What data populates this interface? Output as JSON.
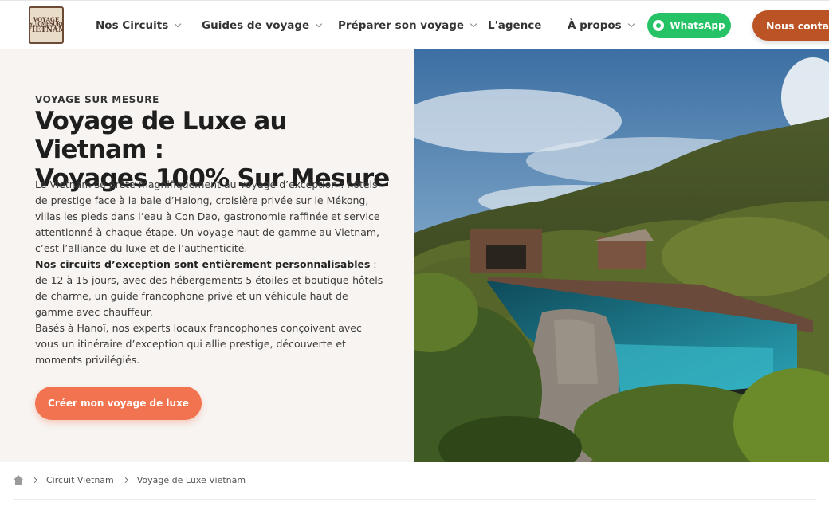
{
  "brand": {
    "logo_line1": "VOYAGE",
    "logo_line2": "SUR MESURE",
    "logo_line3": "VIETNAM"
  },
  "nav": {
    "items": [
      {
        "label": "Nos Circuits",
        "has_dropdown": true
      },
      {
        "label": "Guides de voyage",
        "has_dropdown": true
      },
      {
        "label": "Préparer son voyage",
        "has_dropdown": true
      },
      {
        "label": "L'agence",
        "has_dropdown": false
      },
      {
        "label": "À propos",
        "has_dropdown": true
      }
    ],
    "whatsapp_label": "WhatsApp",
    "contact_label": "Nous contacter"
  },
  "hero": {
    "eyebrow": "VOYAGE SUR MESURE",
    "title_line1": "Voyage de Luxe au Vietnam :",
    "title_line2": "Voyages 100% Sur Mesure",
    "paragraph1": "Le Vietnam se prête magnifiquement au voyage d’exception : hôtels de prestige face à la baie d’Halong, croisière privée sur le Mékong, villas les pieds dans l’eau à Con Dao, gastronomie raffinée et service attentionné à chaque étape. Un voyage haut de gamme au Vietnam, c’est l’alliance du luxe et de l’authenticité.",
    "paragraph2_bold": "Nos circuits d’exception sont entièrement personnalisables",
    "paragraph2_rest": " : de 12 à 15 jours, avec des hébergements 5 étoiles et boutique-hôtels de charme, un guide francophone privé et un véhicule haut de gamme avec chauffeur.",
    "paragraph3": "Basés à Hanoï, nos experts locaux francophones conçoivent avec vous un itinéraire d’exception qui allie prestige, découverte et moments privilégiés.",
    "cta_label": "Créer mon voyage de luxe"
  },
  "breadcrumb": {
    "items": [
      "Circuit Vietnam",
      "Voyage de Luxe Vietnam"
    ]
  },
  "colors": {
    "whatsapp": "#25c365",
    "contact": "#bb5324",
    "cta": "#f2734f",
    "hero_bg": "#f7f4f1"
  }
}
